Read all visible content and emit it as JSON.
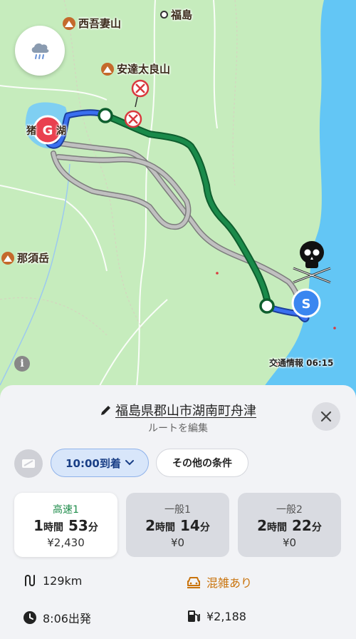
{
  "map": {
    "labels": {
      "nishiazuma": "西吾妻山",
      "fukushima": "福島",
      "adatara": "安達太良山",
      "nasu": "那須岳",
      "inawashiro": "猪　　湖"
    },
    "traffic_info": "交通情報 06:15",
    "goal_marker": "G",
    "start_marker": "S",
    "colors": {
      "land": "#c6ecbd",
      "sea": "#63c6f5",
      "highway_route": "#1a8a4a",
      "alt_route": "#a3a3a3",
      "start": "#3a86f0",
      "goal": "#e9404f"
    }
  },
  "panel": {
    "destination": "福島県郡山市湖南町舟津",
    "edit_route": "ルートを編集",
    "arrival_time": "10:00",
    "arrival_suffix": "到着",
    "other_conditions": "その他の条件",
    "routes": [
      {
        "name": "高速1",
        "hours": "1",
        "hour_unit": "時間",
        "minutes": "53",
        "min_unit": "分",
        "fare": "¥2,430",
        "selected": true
      },
      {
        "name": "一般1",
        "hours": "2",
        "hour_unit": "時間",
        "minutes": "14",
        "min_unit": "分",
        "fare": "¥0",
        "selected": false
      },
      {
        "name": "一般2",
        "hours": "2",
        "hour_unit": "時間",
        "minutes": "22",
        "min_unit": "分",
        "fare": "¥0",
        "selected": false
      }
    ],
    "distance": "129km",
    "congestion": "混雑あり",
    "departure": "8:06出発",
    "fuel_cost": "¥2,188"
  }
}
